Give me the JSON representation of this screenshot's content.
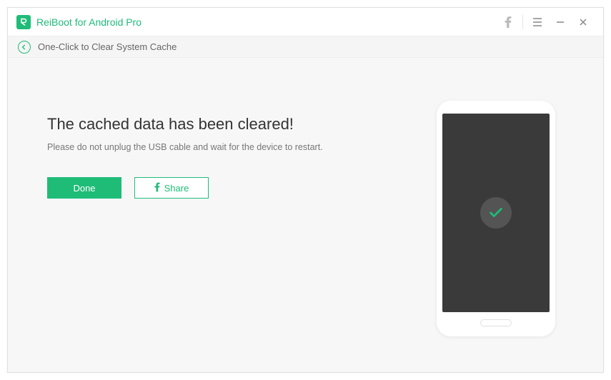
{
  "app": {
    "title": "ReiBoot for Android Pro"
  },
  "subheader": {
    "title": "One-Click to Clear System Cache"
  },
  "main": {
    "heading": "The cached data has been cleared!",
    "subtitle": "Please do not unplug the USB cable and wait for the device to restart.",
    "buttons": {
      "done": "Done",
      "share": "Share"
    }
  },
  "colors": {
    "accent": "#1FBC78"
  }
}
